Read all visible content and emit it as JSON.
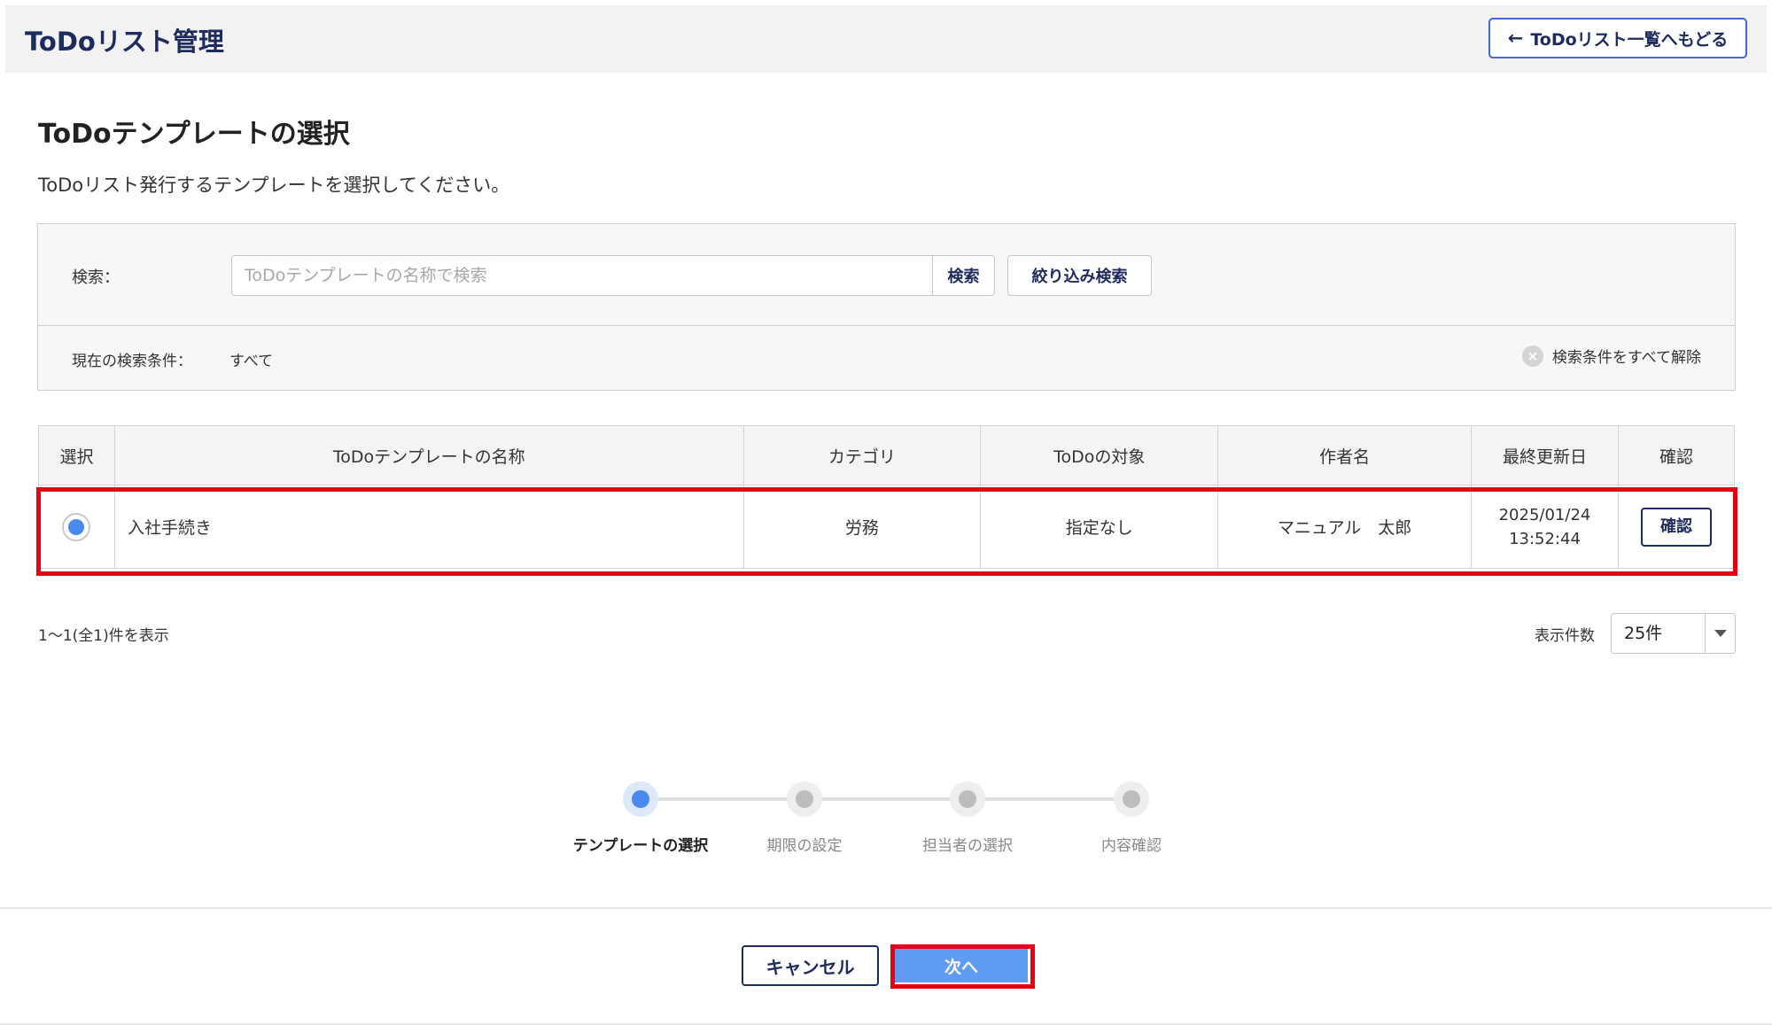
{
  "header": {
    "title": "ToDoリスト管理",
    "back_label": "ToDoリスト一覧へもどる",
    "back_icon": "arrow-left-icon"
  },
  "page": {
    "title": "ToDoテンプレートの選択",
    "description": "ToDoリスト発行するテンプレートを選択してください。"
  },
  "search": {
    "label": "検索：",
    "placeholder": "ToDoテンプレートの名称で検索",
    "value": "",
    "search_button": "検索",
    "filter_button": "絞り込み検索",
    "condition_label": "現在の検索条件：",
    "condition_value": "すべて",
    "clear_label": "検索条件をすべて解除",
    "clear_icon": "clear-circle-icon"
  },
  "table": {
    "columns": [
      "選択",
      "ToDoテンプレートの名称",
      "カテゴリ",
      "ToDoの対象",
      "作者名",
      "最終更新日",
      "確認"
    ],
    "rows": [
      {
        "selected": true,
        "name": "入社手続き",
        "category": "労務",
        "target": "指定なし",
        "author": "マニュアル　太郎",
        "date": "2025/01/24",
        "time": "13:52:44",
        "confirm_label": "確認"
      }
    ]
  },
  "pagination": {
    "count_text": "1～1(全1)件を表示",
    "page_size_label": "表示件数",
    "page_size_value": "25件"
  },
  "steps": [
    {
      "label": "テンプレートの選択",
      "active": true
    },
    {
      "label": "期限の設定",
      "active": false
    },
    {
      "label": "担当者の選択",
      "active": false
    },
    {
      "label": "内容確認",
      "active": false
    }
  ],
  "footer": {
    "cancel_label": "キャンセル",
    "next_label": "次へ"
  },
  "colors": {
    "accent": "#4a8af0",
    "navy": "#1d2b5e",
    "highlight": "#e60012"
  }
}
